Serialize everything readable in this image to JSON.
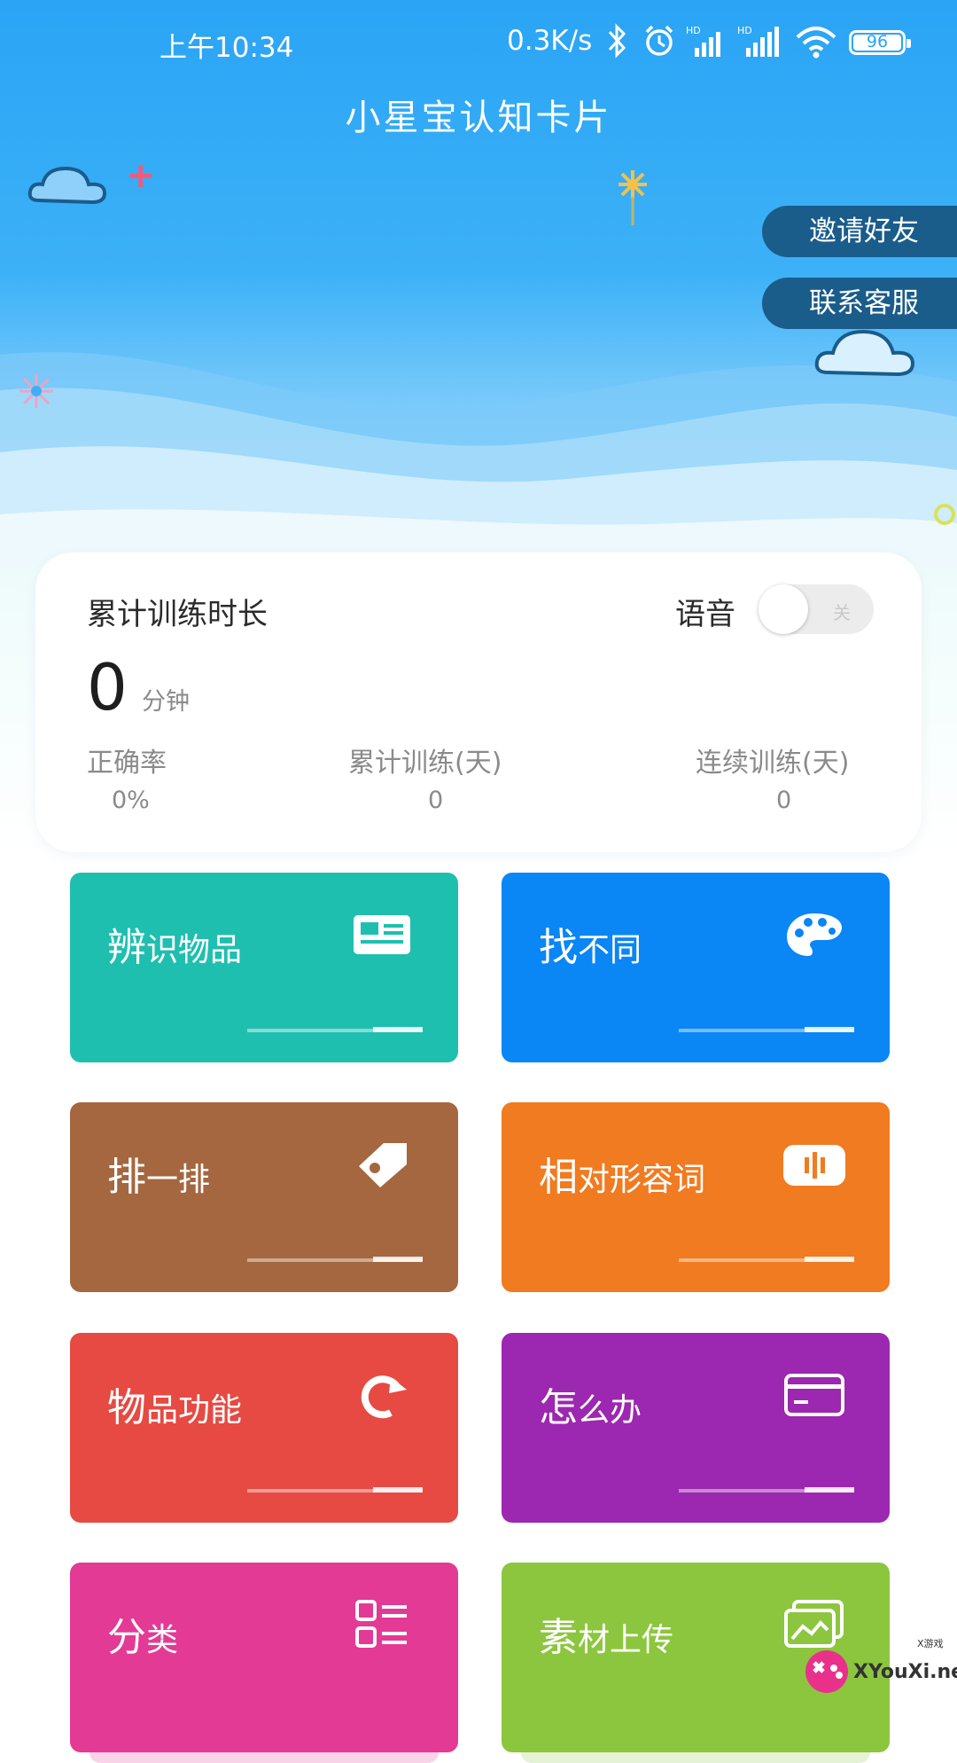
{
  "status_bar": {
    "time": "上午10:34",
    "speed": "0.3K/s",
    "battery": "96",
    "icons": [
      "bluetooth-icon",
      "alarm-icon",
      "signal-icon",
      "wifi-icon",
      "battery-icon"
    ]
  },
  "header": {
    "title": "小星宝认知卡片",
    "invite_label": "邀请好友",
    "contact_label": "联系客服"
  },
  "stats": {
    "title": "累计训练时长",
    "voice_label": "语音",
    "voice_toggle": "关",
    "minutes_value": "0",
    "minutes_unit": "分钟",
    "accuracy_label": "正确率",
    "accuracy_value": "0%",
    "total_days_label": "累计训练(天)",
    "total_days_value": "0",
    "streak_days_label": "连续训练(天)",
    "streak_days_value": "0"
  },
  "tiles": [
    {
      "first": "辨",
      "rest": "识物品",
      "color": "#1fbfb0",
      "icon": "id-card-icon"
    },
    {
      "first": "找",
      "rest": "不同",
      "color": "#0a86f5",
      "icon": "palette-icon"
    },
    {
      "first": "排",
      "rest": "一排",
      "color": "#a4673f",
      "icon": "tag-icon"
    },
    {
      "first": "相",
      "rest": "对形容词",
      "color": "#f07b20",
      "icon": "audio-bars-icon"
    },
    {
      "first": "物",
      "rest": "品功能",
      "color": "#e64a42",
      "icon": "refresh-icon"
    },
    {
      "first": "怎",
      "rest": "么办",
      "color": "#9c27b0",
      "icon": "card-icon"
    },
    {
      "first": "分",
      "rest": "类",
      "color": "#e33a96",
      "icon": "list-icon"
    },
    {
      "first": "素",
      "rest": "材上传",
      "color": "#8cc63e",
      "icon": "gallery-icon"
    }
  ],
  "watermark": {
    "small": "X游戏",
    "text": "XYouXi.net"
  },
  "colors": {
    "sky": "#2aa4f5",
    "pill": "#1a5c8a"
  }
}
